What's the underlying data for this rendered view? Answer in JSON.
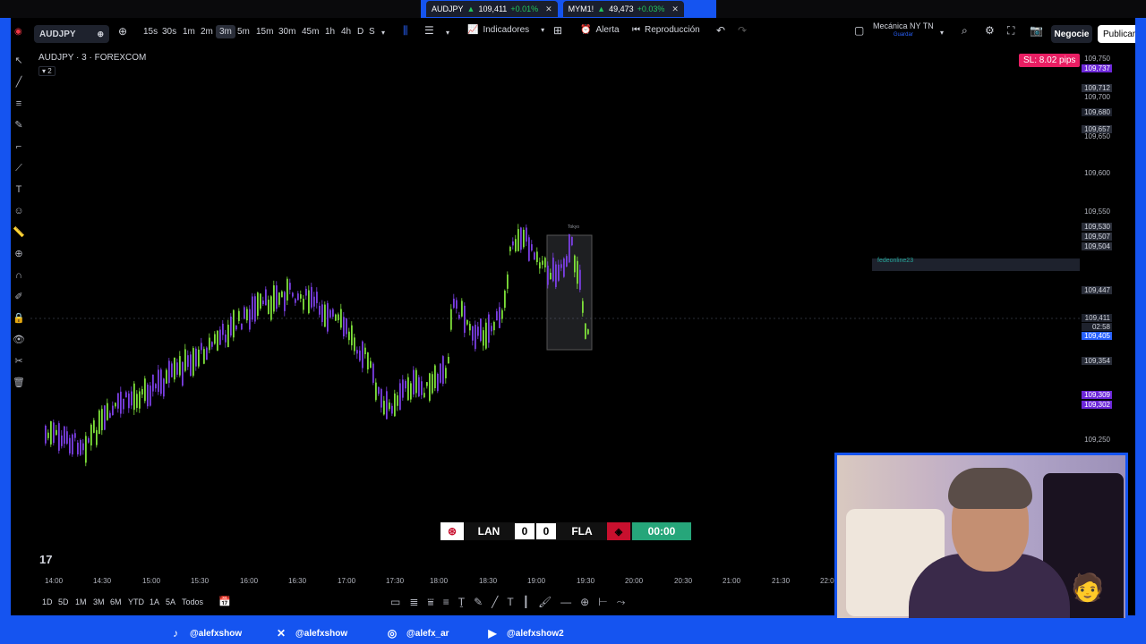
{
  "browser": {
    "tabs": [
      {
        "symbol": "AUDJPY",
        "price": "109,411",
        "change": "+0.01%"
      },
      {
        "symbol": "MYM1!",
        "price": "49,473",
        "change": "+0.03%"
      }
    ]
  },
  "toolbar": {
    "symbol": "AUDJPY",
    "intervals": [
      "15s",
      "30s",
      "1m",
      "2m",
      "3m",
      "5m",
      "15m",
      "30m",
      "45m",
      "1h",
      "4h",
      "D",
      "S"
    ],
    "active_interval": "3m",
    "indicators_label": "Indicadores",
    "alert_label": "Alerta",
    "replay_label": "Reproducción",
    "layout_name": "Mecánica NY TN",
    "layout_status": "Guardar",
    "trade_label": "Negocie",
    "publish_label": "Publicar"
  },
  "chart": {
    "legend_title": "AUDJPY · 3 · FOREXCOM",
    "legend_sub": "2",
    "sl_badge": "SL: 8.02 pips",
    "drawing_label": "fedeonline23",
    "box_label": "Tokyo"
  },
  "price_axis": {
    "labels": [
      {
        "text": "109,750",
        "style": "plain"
      },
      {
        "text": "109,737",
        "style": "purple"
      },
      {
        "text": "109,712",
        "style": "box"
      },
      {
        "text": "109,700",
        "style": "plain"
      },
      {
        "text": "109,680",
        "style": "dark"
      },
      {
        "text": "109,657",
        "style": "box"
      },
      {
        "text": "109,650",
        "style": "plain"
      },
      {
        "text": "109,600",
        "style": "plain"
      },
      {
        "text": "109,550",
        "style": "plain"
      },
      {
        "text": "109,530",
        "style": "box"
      },
      {
        "text": "109,507",
        "style": "box"
      },
      {
        "text": "109,504",
        "style": "box"
      },
      {
        "text": "109,447",
        "style": "box"
      },
      {
        "text": "109,411",
        "style": "dark"
      },
      {
        "text": "02:58",
        "style": "dark"
      },
      {
        "text": "109,405",
        "style": "blue"
      },
      {
        "text": "109,354",
        "style": "box"
      },
      {
        "text": "109,309",
        "style": "purple"
      },
      {
        "text": "109,302",
        "style": "purple"
      },
      {
        "text": "109,250",
        "style": "plain"
      }
    ]
  },
  "time_axis": [
    "14:00",
    "14:30",
    "15:00",
    "15:30",
    "16:00",
    "16:30",
    "17:00",
    "17:30",
    "18:00",
    "18:30",
    "19:00",
    "19:30",
    "20:00",
    "20:30",
    "21:00",
    "21:30",
    "22:00"
  ],
  "bottom_bar": {
    "ranges": [
      "1D",
      "5D",
      "1M",
      "3M",
      "6M",
      "YTD",
      "1A",
      "5A",
      "Todos"
    ]
  },
  "scoreboard": {
    "home": "LAN",
    "away": "FLA",
    "home_score": "0",
    "away_score": "0",
    "clock": "00:00"
  },
  "social": [
    {
      "icon": "tiktok-icon",
      "handle": "@alefxshow"
    },
    {
      "icon": "x-icon",
      "handle": "@alefxshow"
    },
    {
      "icon": "instagram-icon",
      "handle": "@alefx_ar"
    },
    {
      "icon": "youtube-icon",
      "handle": "@alefxshow2"
    }
  ],
  "colors": {
    "frame": "#1554f0",
    "bull": "#7ee03a",
    "bear": "#7b3fe4",
    "sl": "#e91e63",
    "clock": "#26a67a"
  }
}
